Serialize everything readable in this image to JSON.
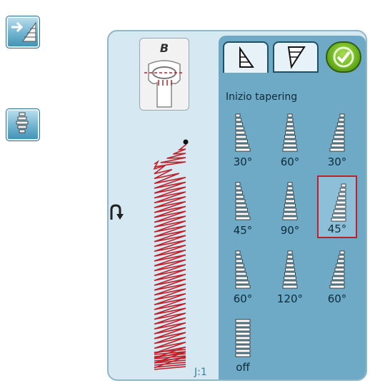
{
  "sidebar": {
    "buttons": [
      {
        "name": "side-tapering-start-button"
      },
      {
        "name": "side-stitch-list-button"
      }
    ]
  },
  "screen": {
    "presser_foot_label": "B",
    "stitch_position_label": "J:1",
    "panel": {
      "title": "Inizio tapering",
      "tabs": [
        "tapering-start",
        "tapering-end"
      ],
      "options": [
        {
          "label": "30°",
          "selected": false
        },
        {
          "label": "60°",
          "selected": false
        },
        {
          "label": "30°",
          "selected": false
        },
        {
          "label": "45°",
          "selected": false
        },
        {
          "label": "90°",
          "selected": false
        },
        {
          "label": "45°",
          "selected": true
        },
        {
          "label": "60°",
          "selected": false
        },
        {
          "label": "120°",
          "selected": false
        },
        {
          "label": "60°",
          "selected": false
        },
        {
          "label": "off",
          "selected": false
        }
      ]
    }
  },
  "colors": {
    "accent": "#c0202a",
    "panel": "#6ea9c6",
    "screen": "#d6e8f1"
  }
}
